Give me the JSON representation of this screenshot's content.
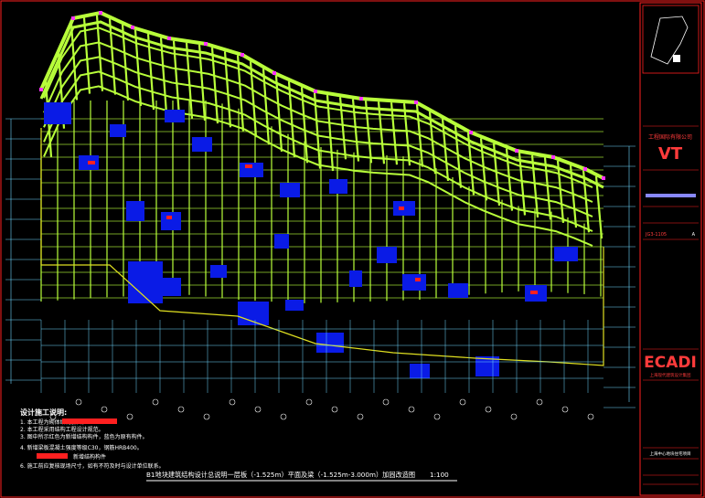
{
  "drawing": {
    "title": "B1地块建筑结构设计总说明一层板（-1.525m）平面及梁（-1.525m-3.000m）加固改造图",
    "scale": "1:100"
  },
  "notes": {
    "heading": "设计施工说明:",
    "items": [
      "1. 本工程为砌体结构加固。",
      "2. 本工程采用结构工程设计规范。",
      "3. 图中所示红色为新增结构构件，蓝色为原有构件。",
      "4. 新增梁板混凝土强度等级C30，钢筋HRB400。",
      "5. 新增钢筋",
      "6. 施工前应复核现场尺寸，如有不符及时与设计单位联系。"
    ],
    "legend": [
      {
        "label": "新增结构构件",
        "color": "#ff2020"
      },
      {
        "label": "新增钢筋",
        "color": "#ff2020"
      }
    ]
  },
  "title_block": {
    "company_top": "上海现代建筑设计集团",
    "company_mid": "工程国际有限公司",
    "logo_text": "VT",
    "ecadi": "ECADI",
    "sheet_code": "JG3-1105",
    "revision": "A",
    "project": "上海中心地块住宅项目"
  },
  "colors": {
    "background": "#000000",
    "beam": "#b8ff3a",
    "wall": "#0a1be6",
    "grid": "#6fd6ff",
    "frame": "#ff2020",
    "text": "#ffffff",
    "marker": "#ff33ff"
  }
}
